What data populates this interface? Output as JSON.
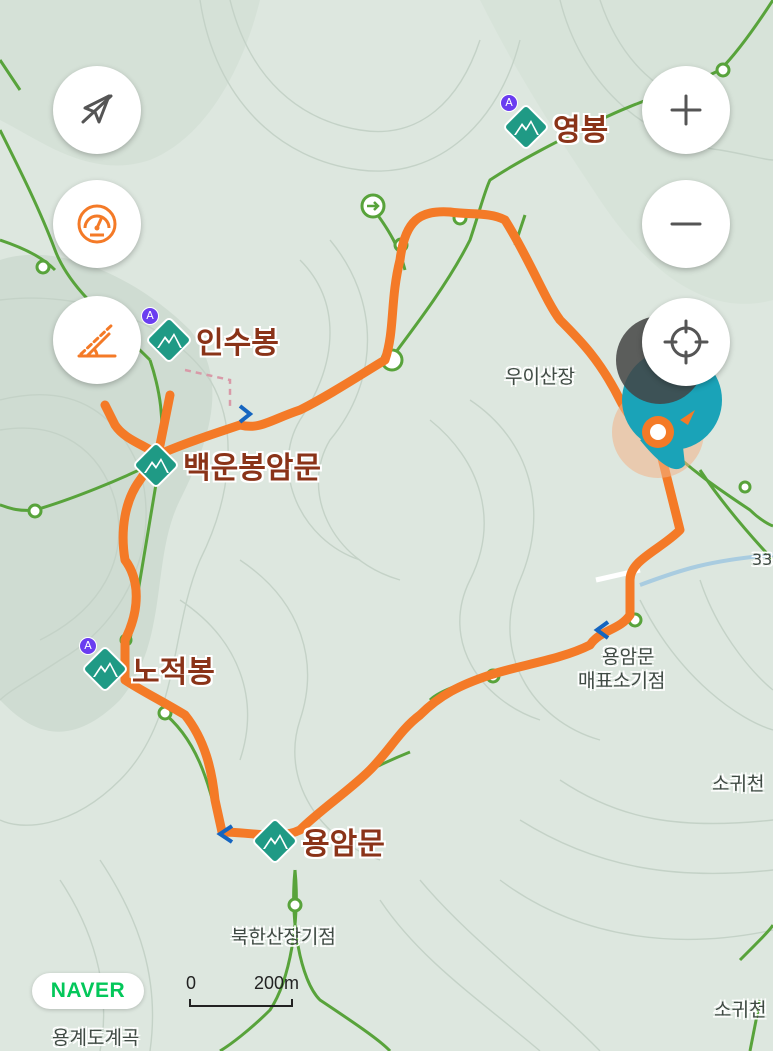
{
  "peaks": [
    {
      "name": "영봉",
      "summit_badge": "A"
    },
    {
      "name": "인수봉",
      "summit_badge": "A"
    },
    {
      "name": "백운봉암문",
      "summit_badge": ""
    },
    {
      "name": "노적봉",
      "summit_badge": "A"
    },
    {
      "name": "용암문",
      "summit_badge": ""
    }
  ],
  "places": {
    "uisan": "우이산장",
    "yongammun_office_line1": "용암문",
    "yongammun_office_line2": "매표소기점",
    "bukhansan": "북한산장기점",
    "sogwi_1": "소귀천",
    "sogwi_2": "소귀천",
    "bottom_partial": "용계도계곡",
    "road_number": "33"
  },
  "controls": {
    "compass_icon": "compass-off-icon",
    "speed_icon": "speedometer-icon",
    "slope_icon": "slope-icon",
    "zoom_in_icon": "plus-icon",
    "zoom_out_icon": "minus-icon",
    "locate_icon": "crosshair-icon"
  },
  "brand": {
    "naver": "NAVER"
  },
  "scale": {
    "start": "0",
    "end": "200m"
  },
  "colors": {
    "route": "#f47a27",
    "trail": "#58a33b",
    "peak_marker": "#1f9a85",
    "label": "#8a3318",
    "naver": "#03c75a"
  }
}
